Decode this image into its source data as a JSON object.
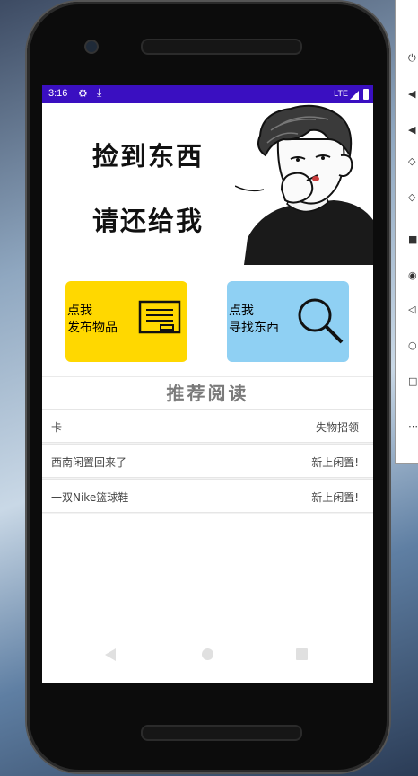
{
  "status_bar": {
    "time": "3:16",
    "network": "LTE",
    "icons": [
      "settings-gear-icon",
      "download-icon",
      "signal-icon",
      "battery-icon"
    ],
    "color": "#3a0fc1"
  },
  "banner": {
    "line1": "捡到东西",
    "line2": "请还给我"
  },
  "tiles": {
    "publish": {
      "line1": "点我",
      "line2": "发布物品",
      "icon": "document-icon",
      "color": "#ffd800"
    },
    "find": {
      "line1": "点我",
      "line2": "寻找东西",
      "icon": "magnifier-icon",
      "color": "#8fd0f3"
    }
  },
  "section": {
    "title": "推荐阅读"
  },
  "list": [
    {
      "title": "卡",
      "tag": "失物招领"
    },
    {
      "title": "西南闲置回来了",
      "tag": "新上闲置!"
    },
    {
      "title": "一双Nike篮球鞋",
      "tag": "新上闲置!"
    }
  ]
}
